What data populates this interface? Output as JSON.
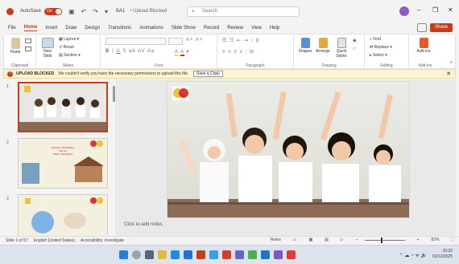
{
  "titlebar": {
    "autosave": "AutoSave",
    "toggle": "On",
    "filename": "BA1",
    "saved": "• Upload Blocked",
    "search_placeholder": "Search"
  },
  "tabs": [
    "File",
    "Home",
    "Insert",
    "Draw",
    "Design",
    "Transitions",
    "Animations",
    "Slide Show",
    "Record",
    "Review",
    "View",
    "Help"
  ],
  "active_tab": "Home",
  "share_label": "Share",
  "ribbon": {
    "groups": [
      "Clipboard",
      "Slides",
      "Font",
      "Paragraph",
      "Drawing",
      "Editing",
      "Add-ins"
    ],
    "paste": "Paste",
    "new_slide": "New Slide",
    "layout": "Layout",
    "reset": "Reset",
    "section": "Section",
    "shapes": "Shapes",
    "arrange": "Arrange",
    "quick_styles": "Quick Styles",
    "find": "Find",
    "replace": "Replace",
    "select": "Select",
    "addins": "Add-ins"
  },
  "infobar": {
    "title": "UPLOAD BLOCKED",
    "message": "We couldn't verify you have the necessary permissions to upload this file.",
    "button": "Save a Copy"
  },
  "slides": {
    "numbers": [
      "1",
      "2",
      "3"
    ],
    "thumb2_title": "RUMAH INDONESIA",
    "thumb2_subtitle": "KELAS",
    "thumb2_line": "TEMA: MERDEKA"
  },
  "notes_placeholder": "Click to add notes",
  "status": {
    "slide": "Slide 1 of 57",
    "language": "English (United States)",
    "accessibility": "Accessibility: Investigate",
    "notes": "Notes",
    "zoom": "82%"
  },
  "taskbar": {
    "time": "15:32",
    "date": "01/12/2025"
  },
  "colors": {
    "accent": "#c43e1c",
    "info_bg": "#fff4ce"
  }
}
